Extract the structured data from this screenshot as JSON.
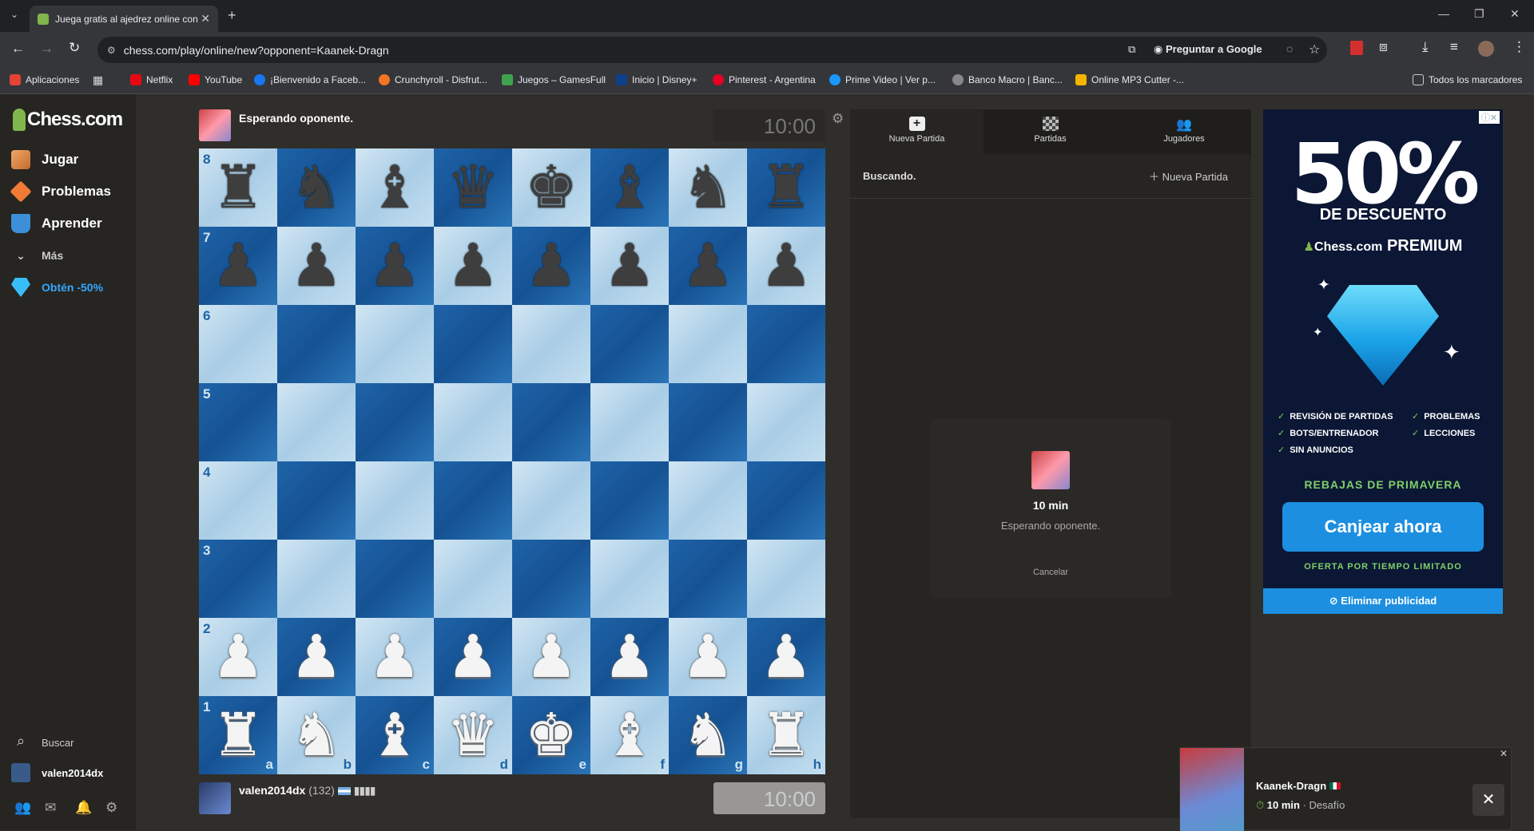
{
  "browser": {
    "tab_title": "Juega gratis al ajedrez online con",
    "url": "chess.com/play/online/new?opponent=Kaanek-Dragn",
    "ask_google": "Preguntar a Google",
    "all_bookmarks": "Todos los marcadores",
    "bookmarks": [
      "Aplicaciones",
      "Netflix",
      "YouTube",
      "¡Bienvenido a Faceb...",
      "Crunchyroll - Disfrut...",
      "Juegos – GamesFull",
      "Inicio | Disney+",
      "Pinterest - Argentina",
      "Prime Video | Ver p...",
      "Banco Macro | Banc...",
      "Online MP3 Cutter -..."
    ]
  },
  "sidebar": {
    "logo": "Chess.com",
    "items": [
      "Jugar",
      "Problemas",
      "Aprender",
      "Más",
      "Obtén -50%"
    ],
    "search": "Buscar",
    "username": "valen2014dx"
  },
  "game": {
    "top_player": "Esperando oponente.",
    "top_clock": "10:00",
    "bottom_player": "valen2014dx",
    "bottom_rating": "(132)",
    "bottom_clock": "10:00",
    "ranks": [
      "8",
      "7",
      "6",
      "5",
      "4",
      "3",
      "2",
      "1"
    ],
    "files": [
      "a",
      "b",
      "c",
      "d",
      "e",
      "f",
      "g",
      "h"
    ],
    "board_colors": {
      "light": "#c4dff0",
      "dark": "#1f63a8"
    }
  },
  "panel": {
    "tabs": [
      "Nueva Partida",
      "Partidas",
      "Jugadores"
    ],
    "status": "Buscando.",
    "new_game": "Nueva Partida",
    "card_time": "10 min",
    "card_status": "Esperando oponente.",
    "card_cancel": "Cancelar"
  },
  "ad": {
    "headline": "50%",
    "sub": "DE DESCUENTO",
    "brand": "Chess.com",
    "premium": "PREMIUM",
    "features_left": [
      "REVISIÓN DE PARTIDAS",
      "BOTS/ENTRENADOR",
      "SIN ANUNCIOS"
    ],
    "features_right": [
      "PROBLEMAS",
      "LECCIONES"
    ],
    "season": "REBAJAS DE PRIMAVERA",
    "cta": "Canjear ahora",
    "limited": "OFERTA POR TIEMPO LIMITADO",
    "remove_ads": "Eliminar publicidad"
  },
  "toast": {
    "name": "Kaanek-Dragn",
    "time": "10 min",
    "type": "· Desafío"
  }
}
